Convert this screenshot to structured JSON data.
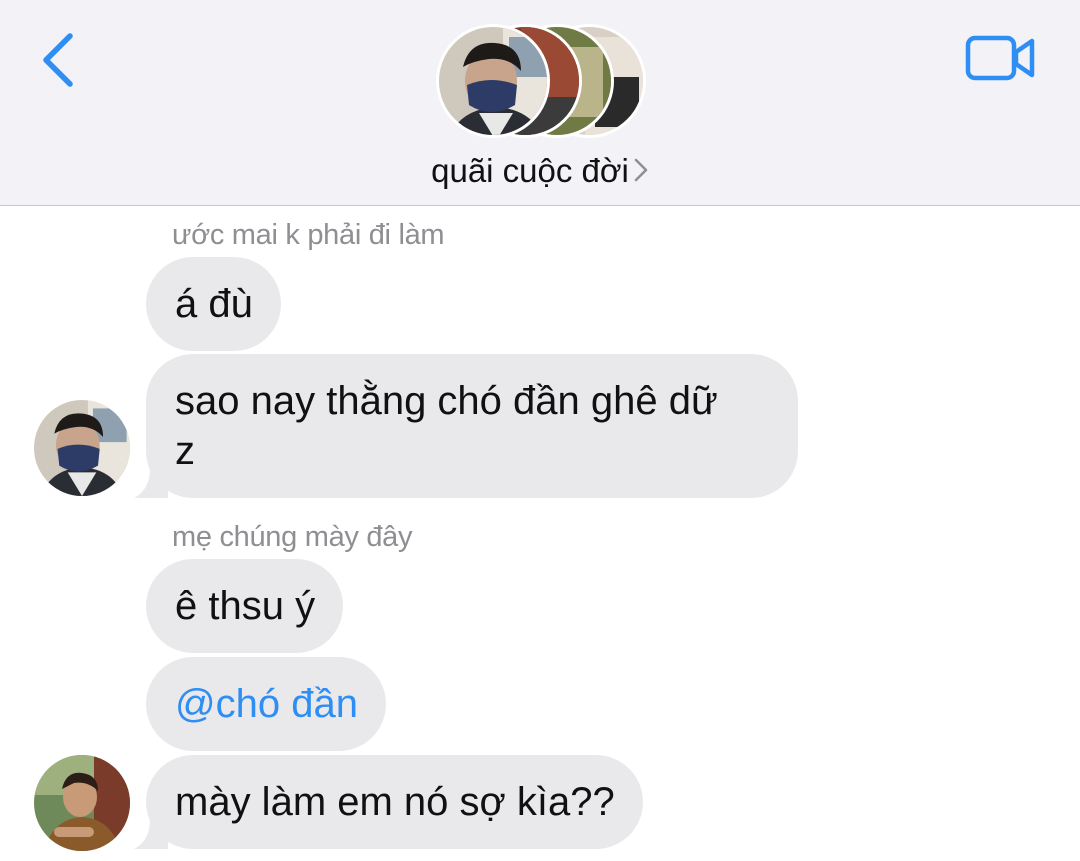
{
  "header": {
    "group_name": "quãi cuộc đời",
    "back_icon": "chevron-left-icon",
    "video_icon": "video-camera-icon",
    "accent_color": "#2f8ef3"
  },
  "messages": {
    "sender_1": "ước mai k phải đi làm",
    "msg_1": "á đù",
    "msg_2_line1": "sao nay thằng chó đần ghê dữ",
    "msg_2_line2": "z",
    "sender_2": "mẹ chúng mày đây",
    "msg_3": "ê thsu ý",
    "msg_4": "@chó đần",
    "msg_5": "mày làm em nó sợ kìa??"
  },
  "colors": {
    "header_bg": "#f2f2f7",
    "bubble_bg": "#e9e9eb",
    "sender_label": "#8e8e93",
    "mention": "#2f8ef3"
  }
}
